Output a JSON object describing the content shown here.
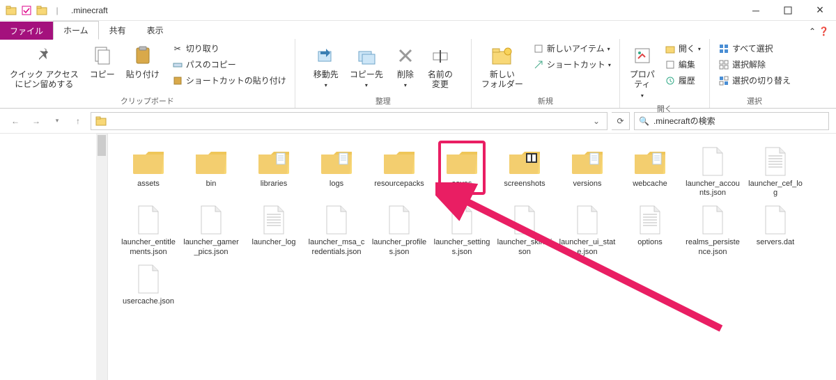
{
  "window": {
    "title": ".minecraft",
    "search_placeholder": ".minecraftの検索"
  },
  "tabs": {
    "file": "ファイル",
    "home": "ホーム",
    "share": "共有",
    "view": "表示"
  },
  "ribbon": {
    "quick_access": {
      "label": "クイック アクセス\nにピン留めする"
    },
    "copy": "コピー",
    "paste": "貼り付け",
    "cut": "切り取り",
    "copy_path": "パスのコピー",
    "paste_shortcut": "ショートカットの貼り付け",
    "group_clipboard": "クリップボード",
    "move_to": "移動先",
    "copy_to": "コピー先",
    "delete": "削除",
    "rename": "名前の\n変更",
    "group_organize": "整理",
    "new_folder": "新しい\nフォルダー",
    "new_item": "新しいアイテム",
    "shortcut": "ショートカット",
    "group_new": "新規",
    "properties": "プロパ\nティ",
    "open": "開く",
    "edit": "編集",
    "history": "履歴",
    "group_open": "開く",
    "select_all": "すべて選択",
    "select_none": "選択解除",
    "invert_selection": "選択の切り替え",
    "group_select": "選択"
  },
  "items": [
    {
      "name": "assets",
      "type": "folder"
    },
    {
      "name": "bin",
      "type": "folder"
    },
    {
      "name": "libraries",
      "type": "folder-doc"
    },
    {
      "name": "logs",
      "type": "folder-doc"
    },
    {
      "name": "resourcepacks",
      "type": "folder"
    },
    {
      "name": "saves",
      "type": "folder",
      "highlight": true
    },
    {
      "name": "screenshots",
      "type": "folder-img"
    },
    {
      "name": "versions",
      "type": "folder-doc"
    },
    {
      "name": "webcache",
      "type": "folder-doc"
    },
    {
      "name": "launcher_accounts.json",
      "type": "file"
    },
    {
      "name": "launcher_cef_log",
      "type": "file-text"
    },
    {
      "name": "launcher_entitlements.json",
      "type": "file"
    },
    {
      "name": "launcher_gamer_pics.json",
      "type": "file"
    },
    {
      "name": "launcher_log",
      "type": "file-text"
    },
    {
      "name": "launcher_msa_credentials.json",
      "type": "file"
    },
    {
      "name": "launcher_profiles.json",
      "type": "file"
    },
    {
      "name": "launcher_settings.json",
      "type": "file"
    },
    {
      "name": "launcher_skins.json",
      "type": "file"
    },
    {
      "name": "launcher_ui_state.json",
      "type": "file"
    },
    {
      "name": "options",
      "type": "file-text"
    },
    {
      "name": "realms_persistence.json",
      "type": "file"
    },
    {
      "name": "servers.dat",
      "type": "file"
    },
    {
      "name": "usercache.json",
      "type": "file"
    }
  ]
}
